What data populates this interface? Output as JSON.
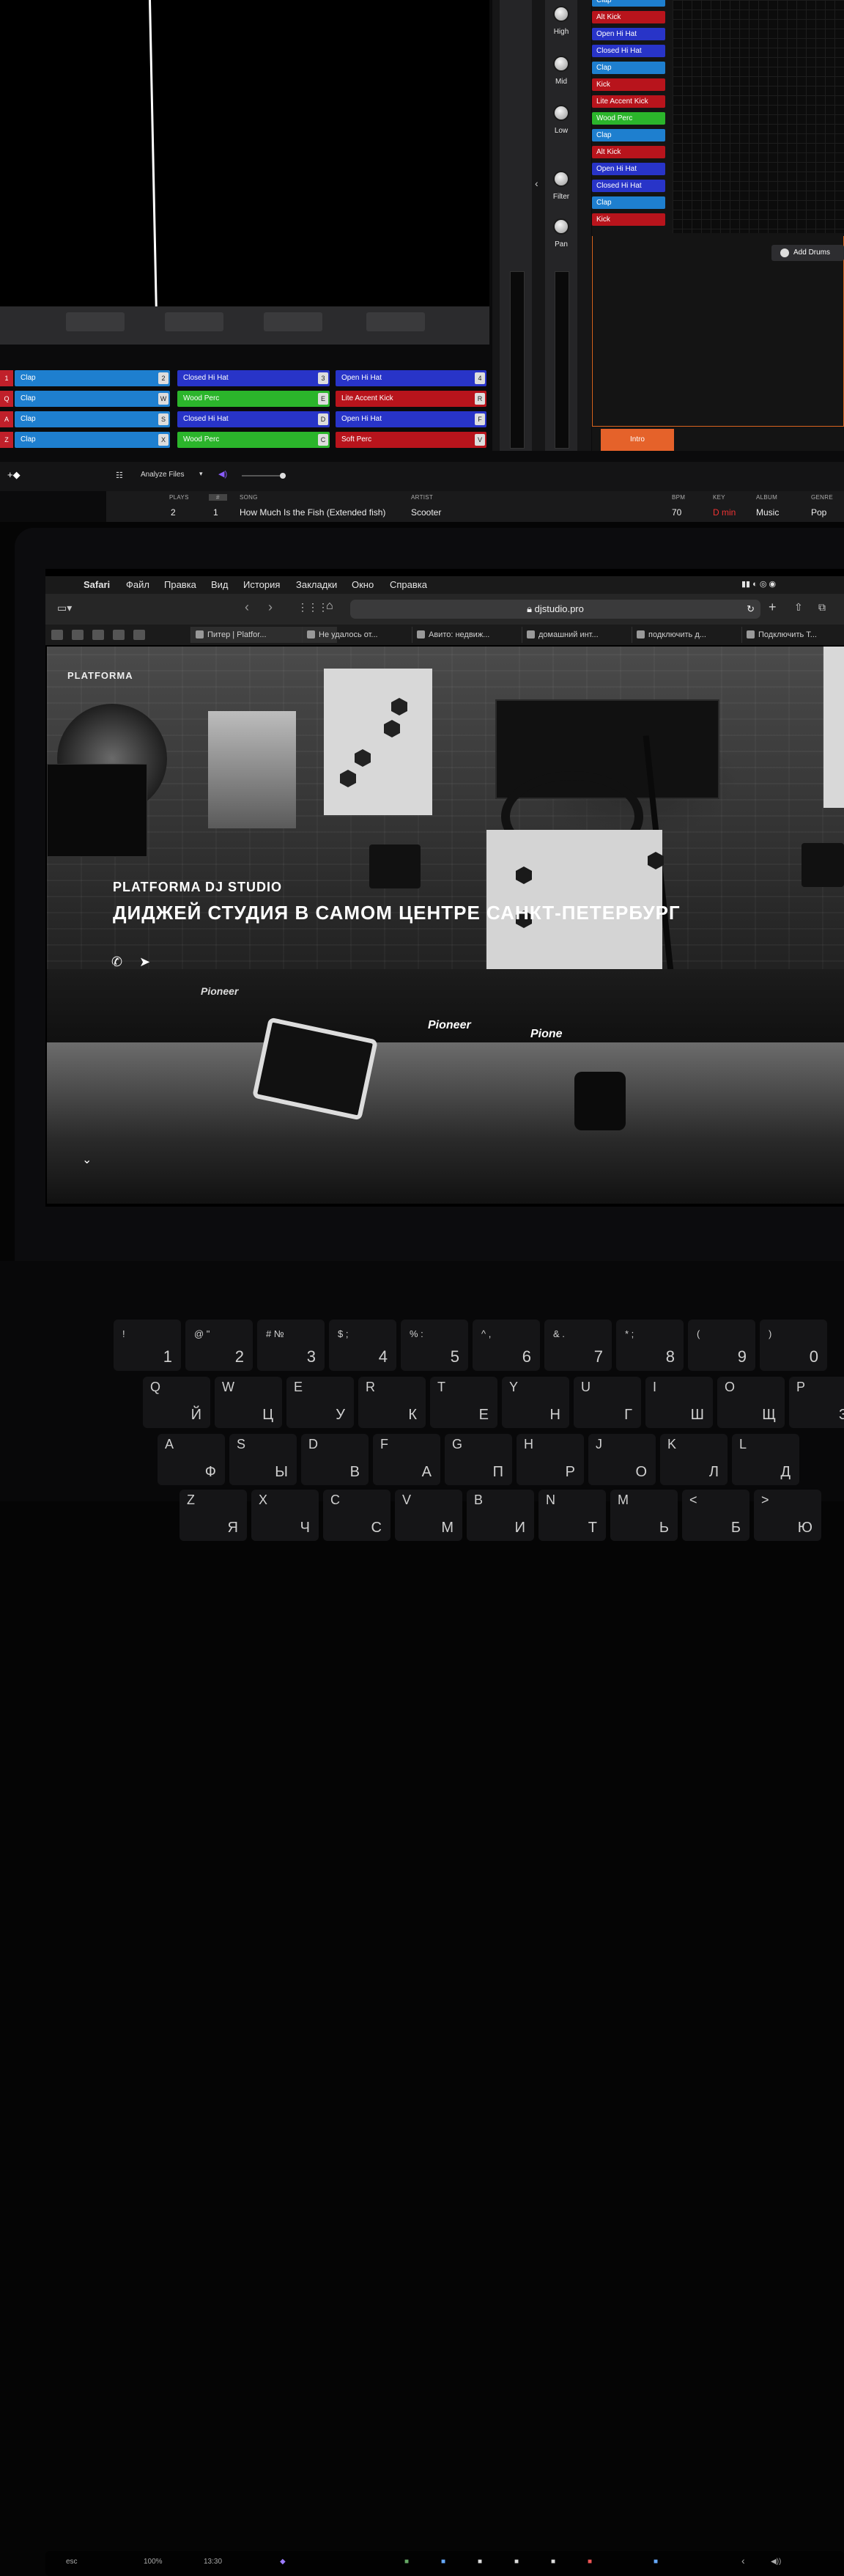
{
  "dj_app": {
    "mixer": {
      "high": "High",
      "mid": "Mid",
      "low": "Low",
      "filter": "Filter",
      "pan": "Pan"
    },
    "sample_slots": [
      {
        "label": "Clap",
        "color": "#1e7fcf"
      },
      {
        "label": "Alt Kick",
        "color": "#b8141c"
      },
      {
        "label": "Open Hi Hat",
        "color": "#2834c8"
      },
      {
        "label": "Closed Hi Hat",
        "color": "#2834c8"
      },
      {
        "label": "Clap",
        "color": "#1e7fcf"
      },
      {
        "label": "Kick",
        "color": "#b8141c"
      },
      {
        "label": "Lite Accent Kick",
        "color": "#b8141c"
      },
      {
        "label": "Wood Perc",
        "color": "#2bb52b"
      },
      {
        "label": "Clap",
        "color": "#1e7fcf"
      },
      {
        "label": "Alt Kick",
        "color": "#b8141c"
      },
      {
        "label": "Open Hi Hat",
        "color": "#2834c8"
      },
      {
        "label": "Closed Hi Hat",
        "color": "#2834c8"
      },
      {
        "label": "Clap",
        "color": "#1e7fcf"
      },
      {
        "label": "Kick",
        "color": "#b8141c"
      }
    ],
    "add_drums": "Add Drums",
    "intro": "Intro",
    "pads": [
      {
        "row": "1",
        "cells": [
          {
            "label": "Clap",
            "key": "2"
          },
          {
            "label": "Closed Hi Hat",
            "key": "3"
          },
          {
            "label": "Open Hi Hat",
            "key": "4"
          }
        ]
      },
      {
        "row": "Q",
        "cells": [
          {
            "label": "Clap",
            "key": "W"
          },
          {
            "label": "Wood Perc",
            "key": "E"
          },
          {
            "label": "Lite Accent Kick",
            "key": "R"
          }
        ]
      },
      {
        "row": "A",
        "cells": [
          {
            "label": "Clap",
            "key": "S"
          },
          {
            "label": "Closed Hi Hat",
            "key": "D"
          },
          {
            "label": "Open Hi Hat",
            "key": "F"
          }
        ]
      },
      {
        "row": "Z",
        "cells": [
          {
            "label": "Clap",
            "key": "X"
          },
          {
            "label": "Wood Perc",
            "key": "C"
          },
          {
            "label": "Soft Perc",
            "key": "V"
          }
        ]
      }
    ],
    "library": {
      "analyze": "Analyze Files",
      "headers": {
        "plays": "PLAYS",
        "num": "#",
        "song": "SONG",
        "artist": "ARTIST",
        "bpm": "BPM",
        "key": "KEY",
        "album": "ALBUM",
        "genre": "GENRE"
      },
      "row": {
        "plays": "2",
        "num": "1",
        "song": "How Much Is the Fish (Extended fish)",
        "artist": "Scooter",
        "bpm": "70",
        "key": "D min",
        "album": "Music",
        "genre": "Pop"
      }
    }
  },
  "macos": {
    "menu": [
      "Safari",
      "Файл",
      "Правка",
      "Вид",
      "История",
      "Закладки",
      "Окно",
      "Справка"
    ],
    "url": "djstudio.pro",
    "tabs": [
      "Питер | Platfor...",
      "Не удалось от...",
      "Авито: недвиж...",
      "домашний инт...",
      "подключить д...",
      "Подключить Т..."
    ]
  },
  "website": {
    "logo": "PLATFORMA",
    "subtitle": "PLATFORMA DJ STUDIO",
    "title": "ДИДЖЕЙ СТУДИЯ В САМОМ ЦЕНТРЕ САНКТ-ПЕТЕРБУРГ",
    "brand_labels": [
      "Pioneer",
      "Pioneer",
      "Pione"
    ]
  },
  "touchbar": {
    "esc": "esc",
    "battery": "100%",
    "time": "13:30"
  },
  "keyboard": {
    "row1": [
      {
        "t": "!",
        "b": "1"
      },
      {
        "t": "@ \"",
        "b": "2"
      },
      {
        "t": "# №",
        "b": "3"
      },
      {
        "t": "$ ;",
        "b": "4"
      },
      {
        "t": "% :",
        "b": "5"
      },
      {
        "t": "^ ,",
        "b": "6"
      },
      {
        "t": "& .",
        "b": "7"
      },
      {
        "t": "* ;",
        "b": "8"
      },
      {
        "t": "(",
        "b": "9"
      },
      {
        "t": ")",
        "b": "0"
      }
    ],
    "row2": [
      {
        "en": "Q",
        "ru": "Й"
      },
      {
        "en": "W",
        "ru": "Ц"
      },
      {
        "en": "E",
        "ru": "У"
      },
      {
        "en": "R",
        "ru": "К"
      },
      {
        "en": "T",
        "ru": "Е"
      },
      {
        "en": "Y",
        "ru": "Н"
      },
      {
        "en": "U",
        "ru": "Г"
      },
      {
        "en": "I",
        "ru": "Ш"
      },
      {
        "en": "O",
        "ru": "Щ"
      },
      {
        "en": "P",
        "ru": "З"
      }
    ],
    "row3": [
      {
        "en": "A",
        "ru": "Ф"
      },
      {
        "en": "S",
        "ru": "Ы"
      },
      {
        "en": "D",
        "ru": "В"
      },
      {
        "en": "F",
        "ru": "А"
      },
      {
        "en": "G",
        "ru": "П"
      },
      {
        "en": "H",
        "ru": "Р"
      },
      {
        "en": "J",
        "ru": "О"
      },
      {
        "en": "K",
        "ru": "Л"
      },
      {
        "en": "L",
        "ru": "Д"
      }
    ],
    "row4": [
      {
        "en": "Z",
        "ru": "Я"
      },
      {
        "en": "X",
        "ru": "Ч"
      },
      {
        "en": "C",
        "ru": "С"
      },
      {
        "en": "V",
        "ru": "М"
      },
      {
        "en": "B",
        "ru": "И"
      },
      {
        "en": "N",
        "ru": "Т"
      },
      {
        "en": "M",
        "ru": "Ь"
      },
      {
        "en": "<",
        "ru": "Б"
      },
      {
        "en": ">",
        "ru": "Ю"
      }
    ]
  }
}
